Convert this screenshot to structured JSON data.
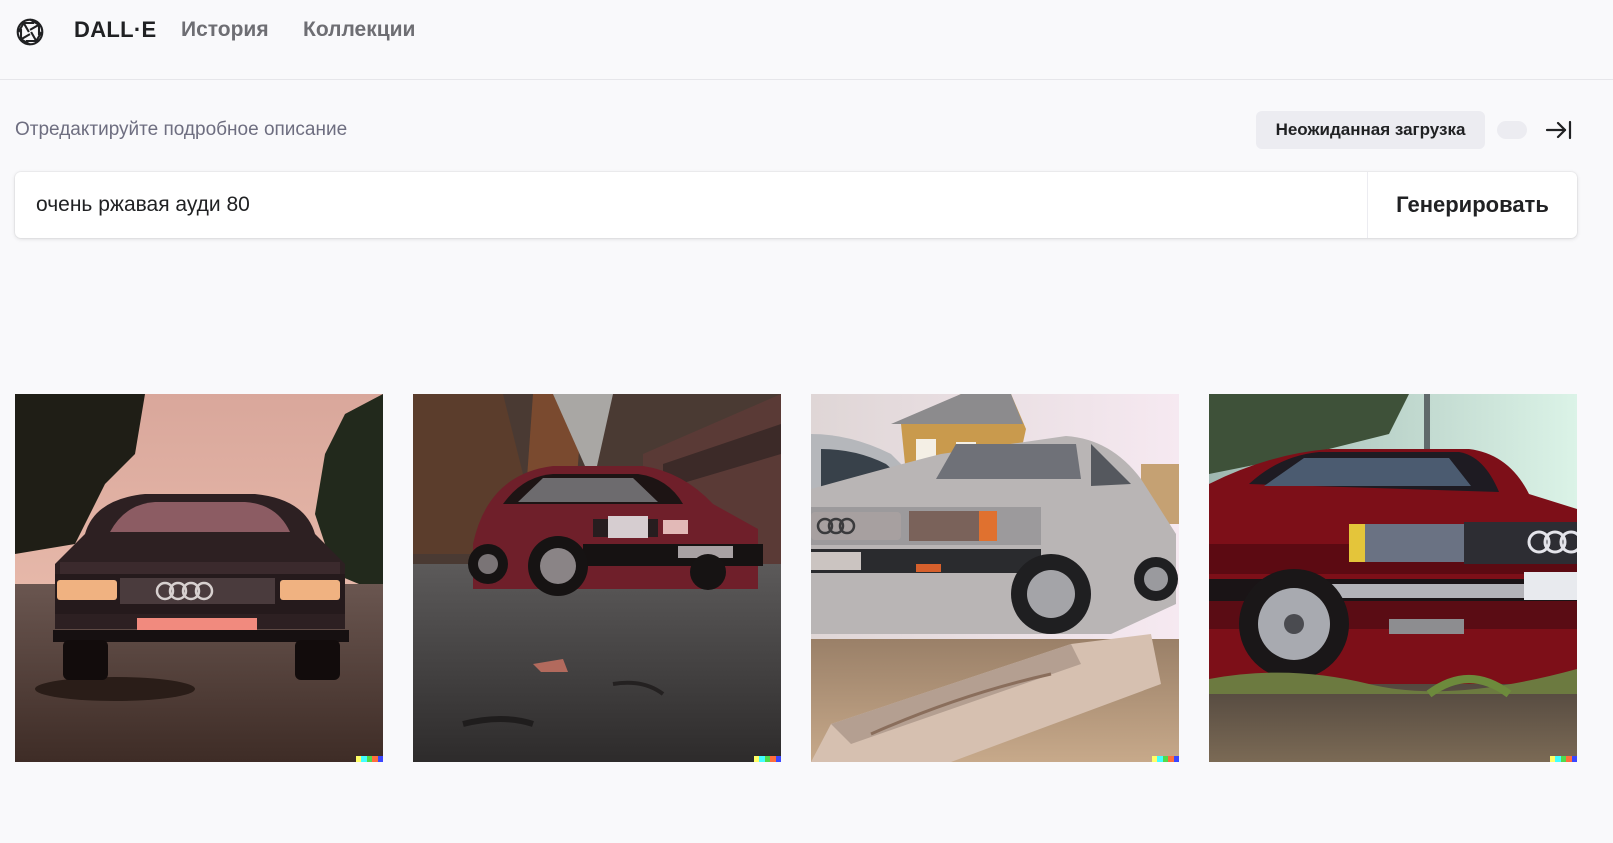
{
  "header": {
    "brand": "DALL·E",
    "nav": [
      {
        "label": "История"
      },
      {
        "label": "Коллекции"
      }
    ]
  },
  "editor": {
    "hint": "Отредактируйте подробное описание",
    "upload_label": "Неожиданная загрузка",
    "prompt_value": "очень ржавая ауди 80",
    "generate_label": "Генерировать"
  },
  "gallery": {
    "images": [
      {
        "subject": "dark red sedan, front view, autumn road, pink sky"
      },
      {
        "subject": "red hatchback on wet asphalt, autumn forest"
      },
      {
        "subject": "silver sedan near old yellow house, concrete curb"
      },
      {
        "subject": "red sedan with chrome grille, grassy ground"
      }
    ],
    "signature_colors": [
      "#ffff66",
      "#42ffff",
      "#51da4c",
      "#ff6e3c",
      "#3c46ff"
    ]
  }
}
